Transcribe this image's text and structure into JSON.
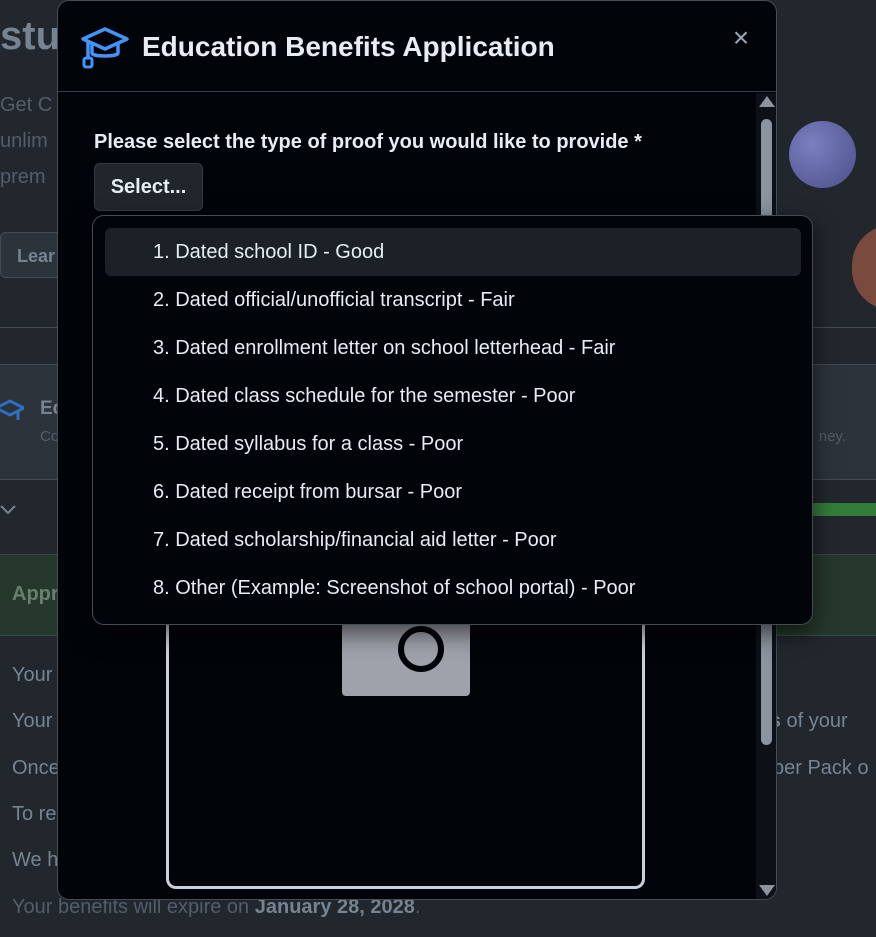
{
  "background": {
    "title": "stu",
    "intro_lines": [
      "Get C",
      "unlim",
      "prem"
    ],
    "learn_button": "Lear",
    "card_title": "Ed",
    "card_sub_left": "Co",
    "card_sub_right": "ney.",
    "banner_text": "Appr",
    "body_lines_left": [
      "Your",
      "Your",
      "Once",
      "To re",
      "We h"
    ],
    "body_right_1_bold": "rs",
    "body_right_1_rest": " of your",
    "body_right_2": "per Pack o",
    "footer_prefix": "Your benefits will expire on ",
    "footer_date": "January 28, 2028",
    "footer_suffix": "."
  },
  "modal": {
    "title": "Education Benefits Application",
    "close_icon": "×",
    "proof_label": "Please select the type of proof you would like to provide *",
    "select_button": "Select..."
  },
  "dropdown": {
    "options": [
      "1. Dated school ID - Good",
      "2. Dated official/unofficial transcript - Fair",
      "3. Dated enrollment letter on school letterhead - Fair",
      "4. Dated class schedule for the semester - Poor",
      "5. Dated syllabus for a class - Poor",
      "6. Dated receipt from bursar - Poor",
      "7. Dated scholarship/financial aid letter - Poor",
      "8. Other (Example: Screenshot of school portal) - Poor"
    ],
    "highlighted_index": 0
  },
  "colors": {
    "accent": "#4493f8",
    "modal_bg": "#010409",
    "progress": "#347d39"
  }
}
